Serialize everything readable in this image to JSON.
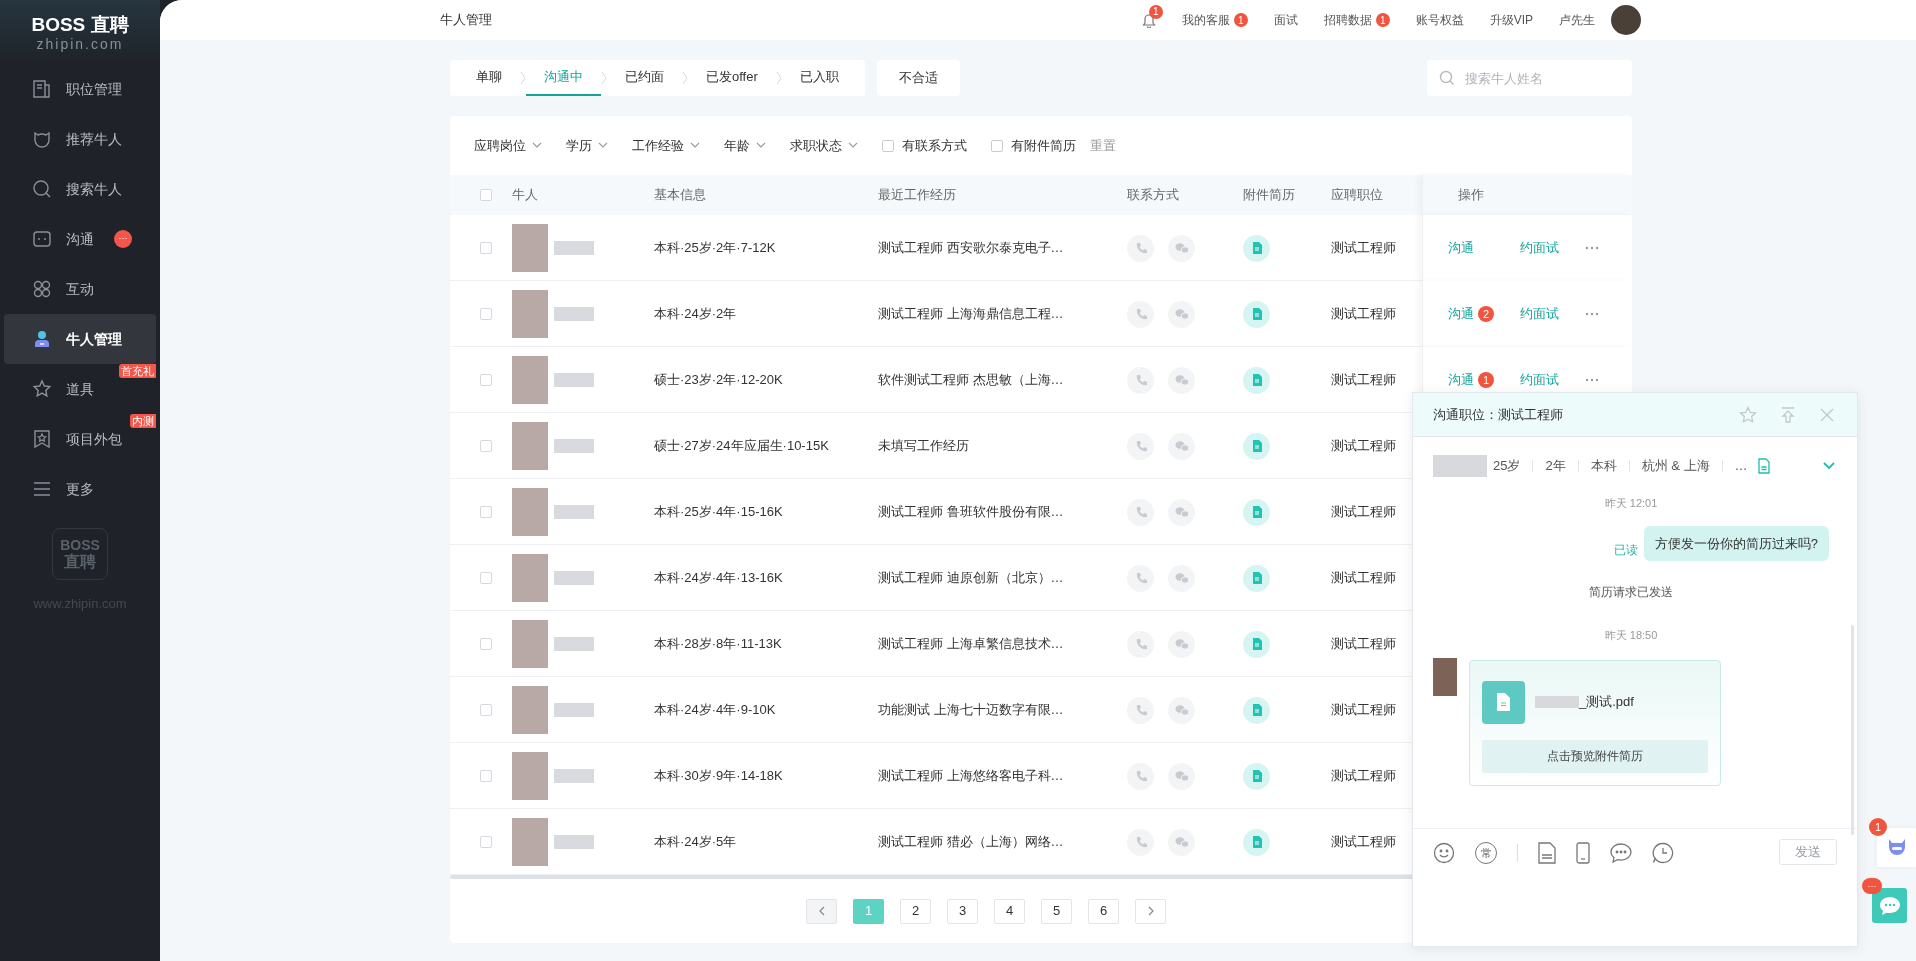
{
  "sidebar": {
    "logo": "BOSS 直聘",
    "logo_domain": "zhipin.com",
    "items": [
      {
        "label": "职位管理",
        "selected": false
      },
      {
        "label": "推荐牛人",
        "selected": false
      },
      {
        "label": "搜索牛人",
        "selected": false
      },
      {
        "label": "沟通",
        "selected": false,
        "badge": "···"
      },
      {
        "label": "互动",
        "selected": false
      },
      {
        "label": "牛人管理",
        "selected": true
      },
      {
        "label": "道具",
        "selected": false,
        "tag": "首充礼"
      },
      {
        "label": "项目外包",
        "selected": false,
        "tag": "内测"
      },
      {
        "label": "更多",
        "selected": false
      }
    ],
    "footer_logo_top": "BOSS",
    "footer_logo_bottom": "直聘",
    "footer_url": "www.zhipin.com"
  },
  "topbar": {
    "title": "牛人管理",
    "bell_badge": "1",
    "links": [
      {
        "label": "我的客服",
        "badge": "1"
      },
      {
        "label": "面试"
      },
      {
        "label": "招聘数据",
        "badge": "1"
      },
      {
        "label": "账号权益"
      },
      {
        "label": "升级VIP"
      },
      {
        "label": "卢先生"
      }
    ]
  },
  "tabs": [
    {
      "label": "单聊",
      "selected": false
    },
    {
      "label": "沟通中",
      "selected": true
    },
    {
      "label": "已约面",
      "selected": false
    },
    {
      "label": "已发offer",
      "selected": false
    },
    {
      "label": "已入职",
      "selected": false
    }
  ],
  "unsuitable_tab": {
    "label": "不合适",
    "selected": false
  },
  "search": {
    "placeholder": "搜索牛人姓名"
  },
  "filters": {
    "dropdowns": [
      "应聘岗位",
      "学历",
      "工作经验",
      "年龄",
      "求职状态"
    ],
    "checkboxes": [
      {
        "label": "有联系方式",
        "checked": false
      },
      {
        "label": "有附件简历",
        "checked": false
      }
    ],
    "reset": "重置"
  },
  "table": {
    "columns": [
      "牛人",
      "基本信息",
      "最近工作经历",
      "联系方式",
      "附件简历",
      "应聘职位",
      "操作"
    ],
    "header_checked": false,
    "rows": [
      {
        "checked": false,
        "basic": "本科·25岁·2年·7-12K",
        "experience": "测试工程师 西安歌尔泰克电子…",
        "position": "测试工程师",
        "actions": {
          "chat": "沟通",
          "interview": "约面试"
        }
      },
      {
        "checked": false,
        "basic": "本科·24岁·2年",
        "experience": "测试工程师 上海海鼎信息工程…",
        "position": "测试工程师",
        "actions": {
          "chat": "沟通",
          "badge": "2",
          "interview": "约面试"
        }
      },
      {
        "checked": false,
        "basic": "硕士·23岁·2年·12-20K",
        "experience": "软件测试工程师 杰思敏（上海…",
        "position": "测试工程师",
        "actions": {
          "chat": "沟通",
          "badge": "1",
          "interview": "约面试"
        }
      },
      {
        "checked": false,
        "basic": "硕士·27岁·24年应届生·10-15K",
        "experience": "未填写工作经历",
        "position": "测试工程师"
      },
      {
        "checked": false,
        "basic": "本科·25岁·4年·15-16K",
        "experience": "测试工程师 鲁班软件股份有限…",
        "position": "测试工程师"
      },
      {
        "checked": false,
        "basic": "本科·24岁·4年·13-16K",
        "experience": "测试工程师 迪原创新（北京）…",
        "position": "测试工程师"
      },
      {
        "checked": false,
        "basic": "本科·28岁·8年·11-13K",
        "experience": "测试工程师 上海卓繁信息技术…",
        "position": "测试工程师"
      },
      {
        "checked": false,
        "basic": "本科·24岁·4年·9-10K",
        "experience": "功能测试 上海七十迈数字有限…",
        "position": "测试工程师"
      },
      {
        "checked": false,
        "basic": "本科·30岁·9年·14-18K",
        "experience": "测试工程师 上海悠络客电子科…",
        "position": "测试工程师"
      },
      {
        "checked": false,
        "basic": "本科·24岁·5年",
        "experience": "测试工程师 猎必（上海）网络…",
        "position": "测试工程师"
      }
    ]
  },
  "pagination": {
    "pages": [
      {
        "label": "1",
        "selected": true
      },
      {
        "label": "2",
        "selected": false
      },
      {
        "label": "3",
        "selected": false
      },
      {
        "label": "4",
        "selected": false
      },
      {
        "label": "5",
        "selected": false
      },
      {
        "label": "6",
        "selected": false
      }
    ]
  },
  "chat_panel": {
    "title": "沟通职位：测试工程师",
    "info": [
      "25岁",
      "2年",
      "本科",
      "杭州 & 上海",
      "…"
    ],
    "messages": [
      {
        "kind": "time",
        "text": "昨天 12:01"
      },
      {
        "kind": "sent",
        "text": "方便发一份你的简历过来吗?",
        "status": "已读"
      },
      {
        "kind": "system",
        "text": "简历请求已发送"
      },
      {
        "kind": "time",
        "text": "昨天 18:50"
      },
      {
        "kind": "file",
        "filename": "_测试.pdf",
        "button": "点击预览附件简历"
      }
    ],
    "quick_reply_label": "常",
    "send_button": {
      "label": "发送",
      "disabled": true
    }
  },
  "floating": {
    "assistant_badge": "1",
    "chat_badge": "···"
  }
}
